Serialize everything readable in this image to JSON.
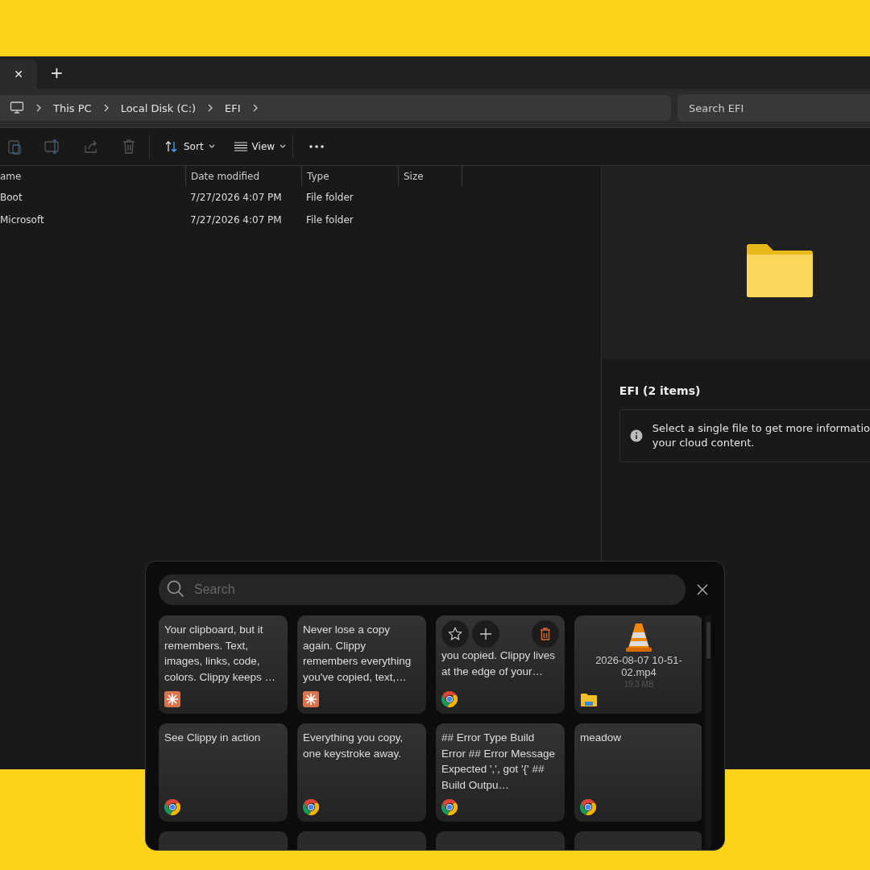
{
  "explorer": {
    "tab_close": "✕",
    "tab_new": "+",
    "breadcrumb": [
      "This PC",
      "Local Disk (C:)",
      "EFI"
    ],
    "search": {
      "placeholder": "Search EFI"
    },
    "toolbar": [
      {
        "label": "Sort",
        "kind": "sort"
      },
      {
        "label": "View",
        "kind": "view"
      }
    ],
    "columns": [
      "ame",
      "Date modified",
      "Type",
      "Size"
    ],
    "rows": [
      {
        "name": "Boot",
        "date": "7/27/2026 4:07 PM",
        "type": "File folder"
      },
      {
        "name": "Microsoft",
        "date": "7/27/2026 4:07 PM",
        "type": "File folder"
      }
    ],
    "details": {
      "title": "EFI (2 items)",
      "info": "Select a single file to get more informatio\nyour cloud content."
    }
  },
  "clipboard": {
    "search": {
      "placeholder": "Search"
    },
    "cards": [
      {
        "kind": "text",
        "text": "Your clipboard, but it remembers. Text, images, links, code, colors. Clippy keeps …",
        "source": {
          "kind": "sparkle"
        },
        "hovered": false
      },
      {
        "kind": "text",
        "text": "Never lose a copy again. Clippy remembers everything you've copied, text,…",
        "source": {
          "kind": "sparkle"
        },
        "hovered": false
      },
      {
        "kind": "text",
        "text": "you copied. Clippy lives at the edge of your…",
        "source": {
          "kind": "browser"
        },
        "hovered": true
      },
      {
        "kind": "file",
        "text": "2026-08-07 10-51-02.mp4",
        "size": "19.3 MB",
        "source": {
          "kind": "folder"
        },
        "hovered": false
      },
      {
        "kind": "text",
        "text": "See Clippy in action",
        "source": {
          "kind": "browser"
        },
        "hovered": false
      },
      {
        "kind": "text",
        "text": "Everything you copy, one keystroke away.",
        "source": {
          "kind": "browser"
        },
        "hovered": false
      },
      {
        "kind": "text",
        "text": "## Error Type Build Error ## Error Message Expected ',', got '{' ## Build Outpu…",
        "source": {
          "kind": "browser"
        },
        "hovered": false
      },
      {
        "kind": "text",
        "text": "meadow",
        "source": {
          "kind": "browser"
        },
        "hovered": false
      }
    ]
  }
}
